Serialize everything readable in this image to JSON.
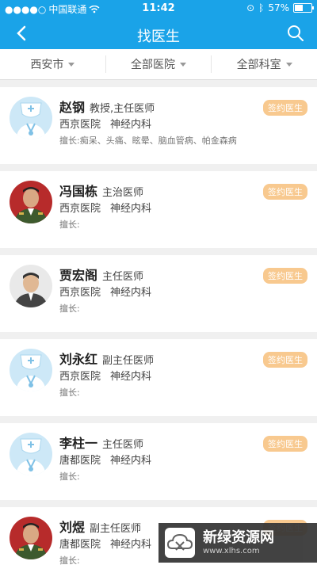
{
  "status_bar": {
    "carrier": "中国联通",
    "time": "11:42",
    "battery": "57%",
    "battery_level": 0.57
  },
  "nav": {
    "title": "找医生",
    "back_icon": "back-chevron-icon",
    "search_icon": "search-icon"
  },
  "filters": [
    {
      "label": "西安市"
    },
    {
      "label": "全部医院"
    },
    {
      "label": "全部科室"
    }
  ],
  "doctors": [
    {
      "name": "赵钢",
      "title": "教授,主任医师",
      "hospital": "西京医院",
      "dept": "神经内科",
      "specialty": "擅长:痴呆、头痛、眩晕、脑血管病、帕金森病",
      "badge": "签约医生",
      "avatar": "nurse-placeholder"
    },
    {
      "name": "冯国栋",
      "title": "主治医师",
      "hospital": "西京医院",
      "dept": "神经内科",
      "specialty": "擅长:",
      "badge": "签约医生",
      "avatar": "military-photo"
    },
    {
      "name": "贾宏阁",
      "title": "主任医师",
      "hospital": "西京医院",
      "dept": "神经内科",
      "specialty": "擅长:",
      "badge": "签约医生",
      "avatar": "civilian-photo"
    },
    {
      "name": "刘永红",
      "title": "副主任医师",
      "hospital": "西京医院",
      "dept": "神经内科",
      "specialty": "擅长:",
      "badge": "签约医生",
      "avatar": "nurse-placeholder"
    },
    {
      "name": "李柱一",
      "title": "主任医师",
      "hospital": "唐都医院",
      "dept": "神经内科",
      "specialty": "擅长:",
      "badge": "签约医生",
      "avatar": "nurse-placeholder"
    },
    {
      "name": "刘煜",
      "title": "副主任医师",
      "hospital": "唐都医院",
      "dept": "神经内科",
      "specialty": "擅长:",
      "badge": "签约医生",
      "avatar": "military-photo"
    }
  ],
  "watermark": {
    "title": "新绿资源网",
    "url": "www.xlhs.com"
  },
  "colors": {
    "primary": "#1aa3e8",
    "badge": "#f8c98f"
  }
}
